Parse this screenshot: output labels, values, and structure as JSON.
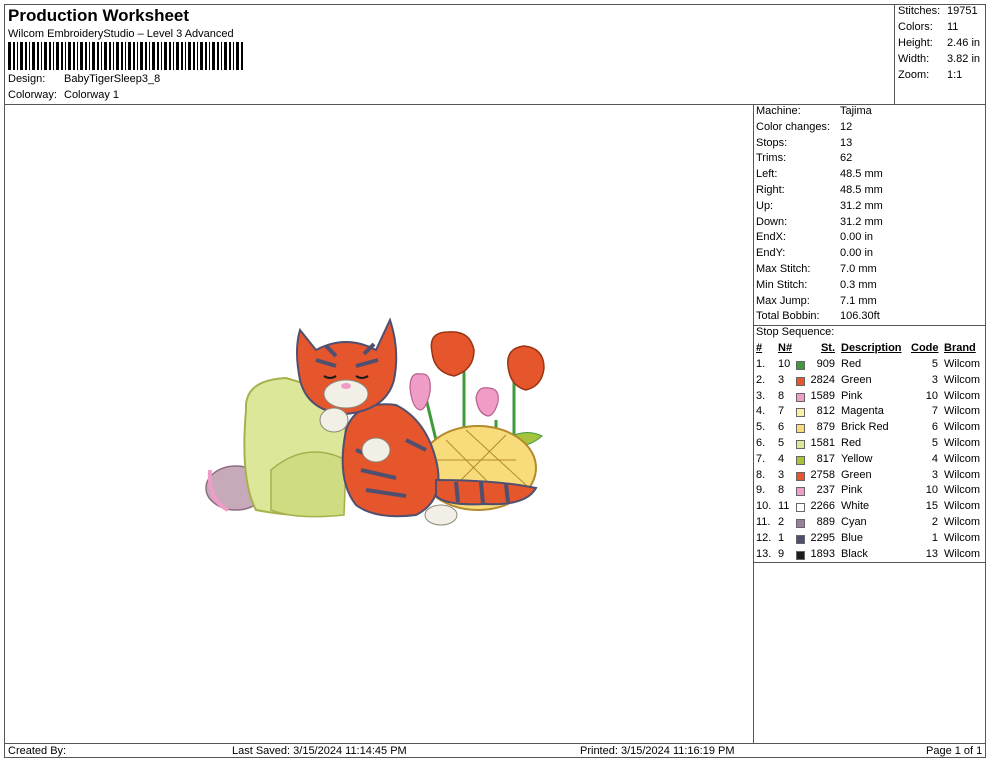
{
  "header": {
    "title": "Production Worksheet",
    "software": "Wilcom EmbroideryStudio – Level 3 Advanced",
    "design_label": "Design:",
    "design_value": "BabyTigerSleep3_8",
    "colorway_label": "Colorway:",
    "colorway_value": "Colorway 1"
  },
  "summary": [
    {
      "label": "Stitches:",
      "value": "19751"
    },
    {
      "label": "Colors:",
      "value": "11"
    },
    {
      "label": "Height:",
      "value": "2.46 in"
    },
    {
      "label": "Width:",
      "value": "3.82 in"
    },
    {
      "label": "Zoom:",
      "value": "1:1"
    }
  ],
  "machine_info": [
    {
      "label": "Machine:",
      "value": "Tajima"
    },
    {
      "label": "Color changes:",
      "value": "12"
    },
    {
      "label": "Stops:",
      "value": "13"
    },
    {
      "label": "Trims:",
      "value": "62"
    },
    {
      "label": "Left:",
      "value": "48.5 mm"
    },
    {
      "label": "Right:",
      "value": "48.5 mm"
    },
    {
      "label": "Up:",
      "value": "31.2 mm"
    },
    {
      "label": "Down:",
      "value": "31.2 mm"
    },
    {
      "label": "EndX:",
      "value": "0.00 in"
    },
    {
      "label": "EndY:",
      "value": "0.00 in"
    },
    {
      "label": "Max Stitch:",
      "value": "7.0 mm"
    },
    {
      "label": "Min Stitch:",
      "value": "0.3 mm"
    },
    {
      "label": "Max Jump:",
      "value": "7.1 mm"
    },
    {
      "label": "Total Bobbin:",
      "value": "106.30ft"
    }
  ],
  "stop_sequence": {
    "title": "Stop Sequence:",
    "headers": {
      "index": "#",
      "n": "N#",
      "st": "St.",
      "description": "Description",
      "code": "Code",
      "brand": "Brand"
    },
    "rows": [
      {
        "index": "1.",
        "n": "10",
        "color": "#3f9a3c",
        "st": "909",
        "description": "Red",
        "code": "5",
        "brand": "Wilcom"
      },
      {
        "index": "2.",
        "n": "3",
        "color": "#e5562c",
        "st": "2824",
        "description": "Green",
        "code": "3",
        "brand": "Wilcom"
      },
      {
        "index": "3.",
        "n": "8",
        "color": "#ef9cc6",
        "st": "1589",
        "description": "Pink",
        "code": "10",
        "brand": "Wilcom"
      },
      {
        "index": "4.",
        "n": "7",
        "color": "#fbf0a8",
        "st": "812",
        "description": "Magenta",
        "code": "7",
        "brand": "Wilcom"
      },
      {
        "index": "5.",
        "n": "6",
        "color": "#f8dc7c",
        "st": "879",
        "description": "Brick Red",
        "code": "6",
        "brand": "Wilcom"
      },
      {
        "index": "6.",
        "n": "5",
        "color": "#dde79a",
        "st": "1581",
        "description": "Red",
        "code": "5",
        "brand": "Wilcom"
      },
      {
        "index": "7.",
        "n": "4",
        "color": "#a7c23c",
        "st": "817",
        "description": "Yellow",
        "code": "4",
        "brand": "Wilcom"
      },
      {
        "index": "8.",
        "n": "3",
        "color": "#e5562c",
        "st": "2758",
        "description": "Green",
        "code": "3",
        "brand": "Wilcom"
      },
      {
        "index": "9.",
        "n": "8",
        "color": "#ef9cc6",
        "st": "237",
        "description": "Pink",
        "code": "10",
        "brand": "Wilcom"
      },
      {
        "index": "10.",
        "n": "11",
        "color": "#ffffff",
        "st": "2266",
        "description": "White",
        "code": "15",
        "brand": "Wilcom"
      },
      {
        "index": "11.",
        "n": "2",
        "color": "#9b7f9a",
        "st": "889",
        "description": "Cyan",
        "code": "2",
        "brand": "Wilcom"
      },
      {
        "index": "12.",
        "n": "1",
        "color": "#4f4f70",
        "st": "2295",
        "description": "Blue",
        "code": "1",
        "brand": "Wilcom"
      },
      {
        "index": "13.",
        "n": "9",
        "color": "#1c1c1c",
        "st": "1893",
        "description": "Black",
        "code": "13",
        "brand": "Wilcom"
      }
    ]
  },
  "footer": {
    "created_by": "Created By:",
    "last_saved": "Last Saved: 3/15/2024 11:14:45 PM",
    "printed": "Printed: 3/15/2024 11:16:19 PM",
    "page": "Page 1 of 1"
  }
}
